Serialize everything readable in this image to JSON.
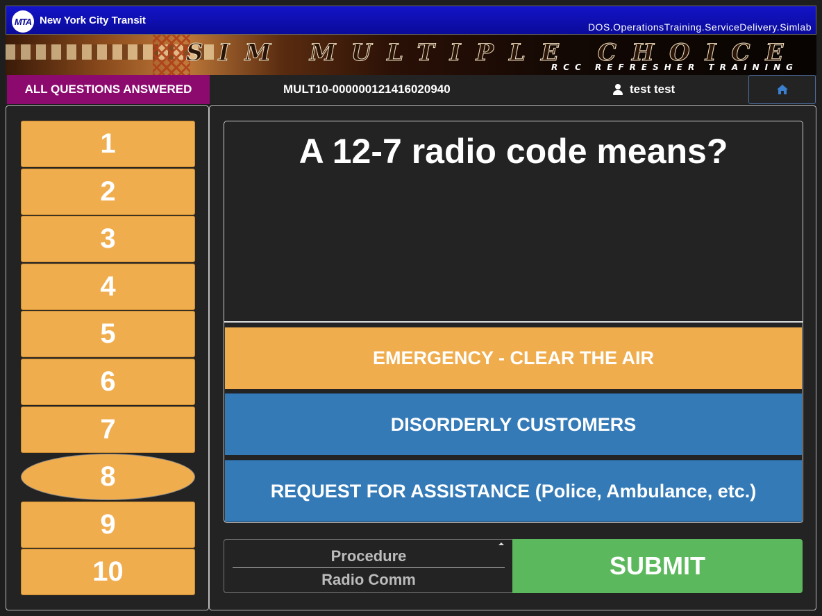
{
  "header": {
    "logo_text": "MTA",
    "agency": "New York City Transit",
    "system": "DOS.OperationsTraining.ServiceDelivery.Simlab",
    "banner_title": "SIM MULTIPLE CHOICE",
    "banner_subtitle": "RCC REFRESHER TRAINING"
  },
  "status": {
    "badge": "ALL QUESTIONS ANSWERED",
    "session_id": "MULT10-000000121416020940",
    "user_name": "test test",
    "home_icon": "home-icon",
    "badge_color": "#8c0a6e"
  },
  "questions": {
    "labels": [
      "1",
      "2",
      "3",
      "4",
      "5",
      "6",
      "7",
      "8",
      "9",
      "10"
    ],
    "current": "8",
    "color": "#f0ad4e"
  },
  "question": {
    "text": "A 12-7 radio code means?",
    "answers": [
      "EMERGENCY - CLEAR THE AIR",
      "DISORDERLY CUSTOMERS",
      "REQUEST FOR ASSISTANCE (Police, Ambulance, etc.)"
    ],
    "highlighted_answer_color": "#f0ad4e",
    "answer_color": "#337ab7"
  },
  "footer": {
    "categories": [
      "Procedure",
      "Radio Comm"
    ],
    "submit_label": "SUBMIT",
    "submit_color": "#5cb85c"
  }
}
